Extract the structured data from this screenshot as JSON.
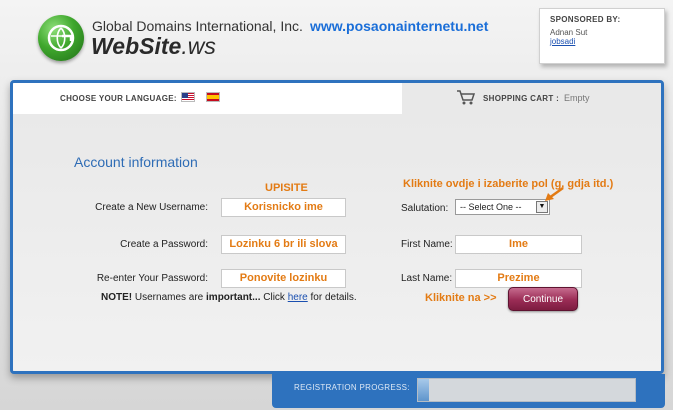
{
  "header": {
    "company": "Global Domains International, Inc.",
    "site_name": "WebSite",
    "site_tld": ".ws",
    "banner_url": "www.posaonainternetu.net"
  },
  "sponsor": {
    "title": "SPONSORED BY:",
    "name": "Adnan Sut",
    "link": "jobsadi"
  },
  "langbar": {
    "label": "CHOOSE YOUR LANGUAGE:",
    "flags": [
      "us-flag-icon",
      "spain-flag-icon"
    ]
  },
  "cart": {
    "label": "SHOPPING CART :",
    "value": "Empty",
    "icon": "cart-icon"
  },
  "form": {
    "title": "Account information",
    "annotation_upisite": "UPISITE",
    "annotation_salutation": "Kliknite ovdje i izaberite pol (g, gdja itd.)",
    "annotation_continue": "Kliknite na >>",
    "username_label": "Create a New Username:",
    "username_value": "Korisnicko ime",
    "password_label": "Create a Password:",
    "password_value": "Lozinku 6 br ili slova",
    "repassword_label": "Re-enter Your Password:",
    "repassword_value": "Ponovite lozinku",
    "salutation_label": "Salutation:",
    "salutation_value": "-- Select One --",
    "firstname_label": "First Name:",
    "firstname_value": "Ime",
    "lastname_label": "Last Name:",
    "lastname_value": "Prezime",
    "note_prefix": "NOTE!",
    "note_text1": " Usernames are ",
    "note_bold": "important...",
    "note_text2": " Click ",
    "note_link": "here",
    "note_text3": " for details.",
    "continue_label": "Continue"
  },
  "progress": {
    "label": "REGISTRATION PROGRESS:",
    "fraction": 0.05
  },
  "colors": {
    "accent_blue": "#2e72be",
    "annotation_orange": "#e37b14",
    "continue_button": "#9a2c55"
  }
}
